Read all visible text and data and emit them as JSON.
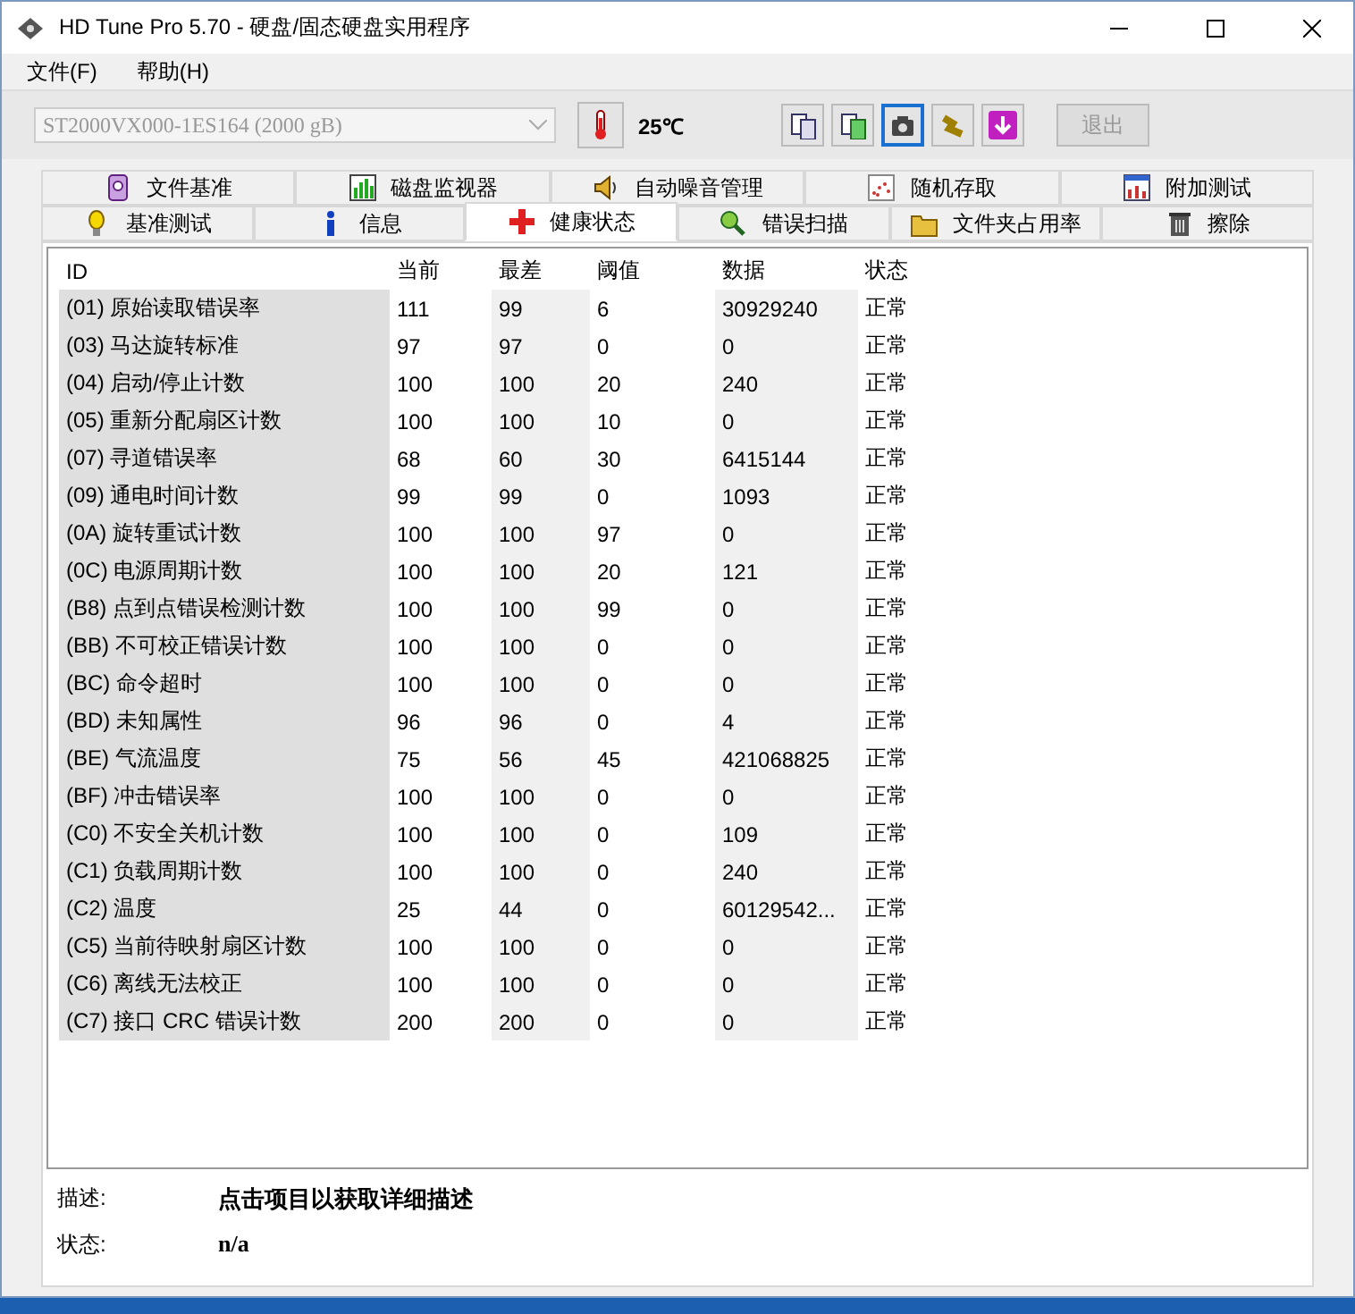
{
  "window": {
    "title": "HD Tune Pro 5.70 - 硬盘/固态硬盘实用程序"
  },
  "menu": [
    {
      "label": "文件(F)"
    },
    {
      "label": "帮助(H)"
    }
  ],
  "toolbar": {
    "drive": {
      "value": "ST2000VX000-1ES164 (2000 gB)",
      "disabled": true
    },
    "temperature": "25℃",
    "tools": [
      {
        "selected": false
      },
      {
        "selected": false
      },
      {
        "selected": true
      },
      {
        "selected": false
      },
      {
        "selected": false
      }
    ],
    "exit": {
      "label": "退出",
      "disabled": true
    }
  },
  "tabs_top": [
    {
      "label": "文件基准",
      "selected": false
    },
    {
      "label": "磁盘监视器",
      "selected": false
    },
    {
      "label": "自动噪音管理",
      "selected": false
    },
    {
      "label": "随机存取",
      "selected": false
    },
    {
      "label": "附加测试",
      "selected": false
    }
  ],
  "tabs_bottom": [
    {
      "label": "基准测试",
      "selected": false
    },
    {
      "label": "信息",
      "selected": false
    },
    {
      "label": "健康状态",
      "selected": true
    },
    {
      "label": "错误扫描",
      "selected": false
    },
    {
      "label": "文件夹占用率",
      "selected": false
    },
    {
      "label": "擦除",
      "selected": false
    }
  ],
  "table": {
    "columns": [
      "ID",
      "当前",
      "最差",
      "阈值",
      "数据",
      "状态"
    ],
    "rows": [
      [
        "(01) 原始读取错误率",
        "111",
        "99",
        "6",
        "30929240",
        "正常"
      ],
      [
        "(03) 马达旋转标准",
        "97",
        "97",
        "0",
        "0",
        "正常"
      ],
      [
        "(04) 启动/停止计数",
        "100",
        "100",
        "20",
        "240",
        "正常"
      ],
      [
        "(05) 重新分配扇区计数",
        "100",
        "100",
        "10",
        "0",
        "正常"
      ],
      [
        "(07) 寻道错误率",
        "68",
        "60",
        "30",
        "6415144",
        "正常"
      ],
      [
        "(09) 通电时间计数",
        "99",
        "99",
        "0",
        "1093",
        "正常"
      ],
      [
        "(0A) 旋转重试计数",
        "100",
        "100",
        "97",
        "0",
        "正常"
      ],
      [
        "(0C) 电源周期计数",
        "100",
        "100",
        "20",
        "121",
        "正常"
      ],
      [
        "(B8) 点到点错误检测计数",
        "100",
        "100",
        "99",
        "0",
        "正常"
      ],
      [
        "(BB) 不可校正错误计数",
        "100",
        "100",
        "0",
        "0",
        "正常"
      ],
      [
        "(BC) 命令超时",
        "100",
        "100",
        "0",
        "0",
        "正常"
      ],
      [
        "(BD) 未知属性",
        "96",
        "96",
        "0",
        "4",
        "正常"
      ],
      [
        "(BE) 气流温度",
        "75",
        "56",
        "45",
        "421068825",
        "正常"
      ],
      [
        "(BF) 冲击错误率",
        "100",
        "100",
        "0",
        "0",
        "正常"
      ],
      [
        "(C0) 不安全关机计数",
        "100",
        "100",
        "0",
        "109",
        "正常"
      ],
      [
        "(C1) 负载周期计数",
        "100",
        "100",
        "0",
        "240",
        "正常"
      ],
      [
        "(C2) 温度",
        "25",
        "44",
        "0",
        "60129542...",
        "正常"
      ],
      [
        "(C5) 当前待映射扇区计数",
        "100",
        "100",
        "0",
        "0",
        "正常"
      ],
      [
        "(C6) 离线无法校正",
        "100",
        "100",
        "0",
        "0",
        "正常"
      ],
      [
        "(C7) 接口 CRC 错误计数",
        "200",
        "200",
        "0",
        "0",
        "正常"
      ]
    ]
  },
  "details": [
    {
      "label": "描述:",
      "value": "点击项目以获取详细描述"
    },
    {
      "label": "状态:",
      "value": "n/a"
    }
  ]
}
